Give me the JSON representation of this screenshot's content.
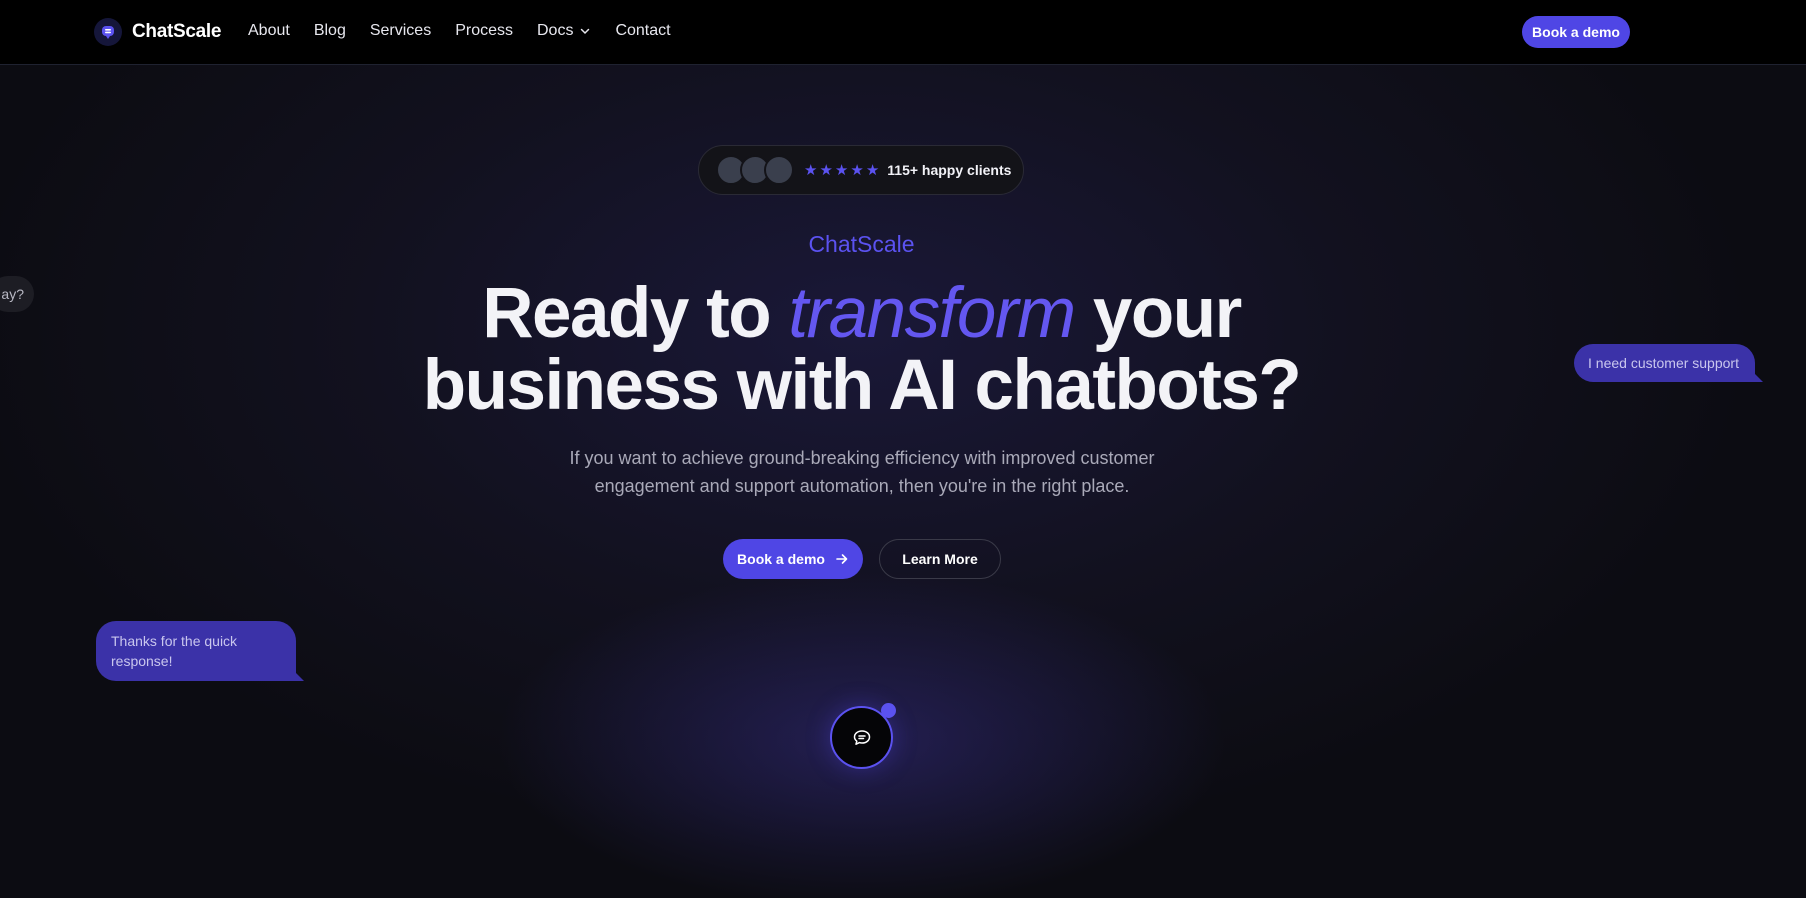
{
  "brand": {
    "name": "ChatScale",
    "accent": "#4f46e5"
  },
  "nav": {
    "items": [
      {
        "label": "About"
      },
      {
        "label": "Blog"
      },
      {
        "label": "Services"
      },
      {
        "label": "Process"
      },
      {
        "label": "Docs",
        "has_dropdown": true
      },
      {
        "label": "Contact"
      }
    ],
    "cta_label": "Book a demo"
  },
  "social_proof": {
    "avatar_count": 3,
    "stars": 5,
    "text": "115+ happy clients"
  },
  "hero": {
    "eyebrow": "ChatScale",
    "headline_part1": "Ready to ",
    "headline_highlight": "transform",
    "headline_part2": " your",
    "headline_line2": "business with AI chatbots?",
    "subtext": "If you want to achieve ground-breaking efficiency with improved customer engagement and support automation, then you're in the right place.",
    "primary_cta": "Book a demo",
    "secondary_cta": "Learn More"
  },
  "bubbles": {
    "left_partial": "ay?",
    "right": "I need customer support",
    "bottom_left": "Thanks for the quick response!"
  },
  "icons": {
    "logo": "chat-bot-icon",
    "dropdown": "chevron-down-icon",
    "cta_arrow": "arrow-right-icon",
    "widget": "chat-bubble-icon"
  }
}
